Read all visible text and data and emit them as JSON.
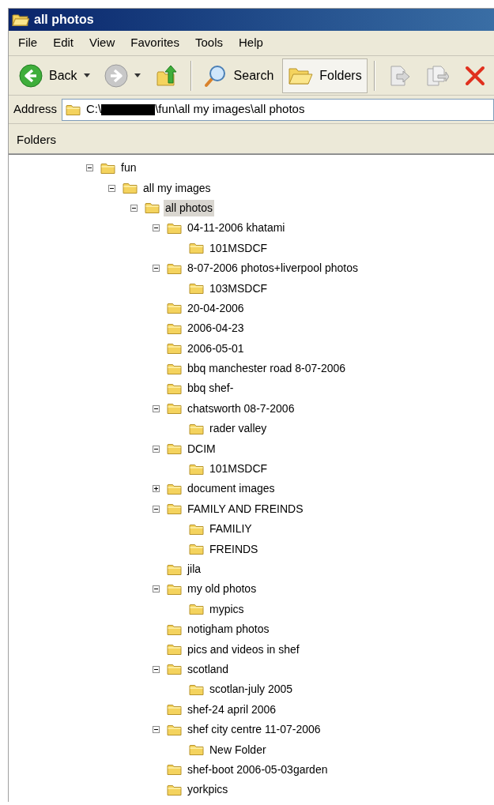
{
  "window": {
    "title": "all photos"
  },
  "menu": [
    {
      "label": "File"
    },
    {
      "label": "Edit"
    },
    {
      "label": "View"
    },
    {
      "label": "Favorites"
    },
    {
      "label": "Tools"
    },
    {
      "label": "Help"
    }
  ],
  "toolbar": [
    {
      "kind": "back",
      "label": "Back",
      "pressed": false
    },
    {
      "kind": "forward",
      "pressed": false
    },
    {
      "kind": "up",
      "pressed": false
    },
    {
      "kind": "separator"
    },
    {
      "kind": "search",
      "label": "Search",
      "pressed": false
    },
    {
      "kind": "folders",
      "label": "Folders",
      "pressed": true
    },
    {
      "kind": "separator"
    },
    {
      "kind": "move",
      "pressed": false
    },
    {
      "kind": "copy",
      "pressed": false
    },
    {
      "kind": "delete",
      "pressed": false
    }
  ],
  "address": {
    "label": "Address",
    "prefix": "C:\\",
    "suffix": "\\fun\\all my images\\all photos"
  },
  "folders_pane": {
    "title": "Folders"
  },
  "tree": [
    {
      "label": "fun",
      "kind": "branch",
      "expanded": true,
      "selected": false,
      "children": [
        {
          "label": "all my images",
          "kind": "branch",
          "expanded": true,
          "selected": false,
          "children": [
            {
              "label": "all photos",
              "kind": "branch",
              "expanded": true,
              "selected": true,
              "children": [
                {
                  "label": "04-11-2006 khatami",
                  "kind": "branch",
                  "expanded": true,
                  "selected": false,
                  "children": [
                    {
                      "label": "101MSDCF",
                      "kind": "leaf",
                      "selected": false
                    }
                  ]
                },
                {
                  "label": "8-07-2006 photos+liverpool photos",
                  "kind": "branch",
                  "expanded": true,
                  "selected": false,
                  "children": [
                    {
                      "label": "103MSDCF",
                      "kind": "leaf",
                      "selected": false
                    }
                  ]
                },
                {
                  "label": "20-04-2006",
                  "kind": "leaf",
                  "selected": false
                },
                {
                  "label": "2006-04-23",
                  "kind": "leaf",
                  "selected": false
                },
                {
                  "label": "2006-05-01",
                  "kind": "leaf",
                  "selected": false
                },
                {
                  "label": "bbq manchester road 8-07-2006",
                  "kind": "leaf",
                  "selected": false
                },
                {
                  "label": "bbq shef-",
                  "kind": "leaf",
                  "selected": false
                },
                {
                  "label": "chatsworth 08-7-2006",
                  "kind": "branch",
                  "expanded": true,
                  "selected": false,
                  "children": [
                    {
                      "label": "rader valley",
                      "kind": "leaf",
                      "selected": false
                    }
                  ]
                },
                {
                  "label": "DCIM",
                  "kind": "branch",
                  "expanded": true,
                  "selected": false,
                  "children": [
                    {
                      "label": "101MSDCF",
                      "kind": "leaf",
                      "selected": false
                    }
                  ]
                },
                {
                  "label": "document images",
                  "kind": "branch",
                  "expanded": false,
                  "selected": false
                },
                {
                  "label": "FAMILY AND FREINDS",
                  "kind": "branch",
                  "expanded": true,
                  "selected": false,
                  "children": [
                    {
                      "label": "FAMILIY",
                      "kind": "leaf",
                      "selected": false
                    },
                    {
                      "label": "FREINDS",
                      "kind": "leaf",
                      "selected": false
                    }
                  ]
                },
                {
                  "label": "jila",
                  "kind": "leaf",
                  "selected": false
                },
                {
                  "label": "my old photos",
                  "kind": "branch",
                  "expanded": true,
                  "selected": false,
                  "children": [
                    {
                      "label": "mypics",
                      "kind": "leaf",
                      "selected": false
                    }
                  ]
                },
                {
                  "label": "notigham photos",
                  "kind": "leaf",
                  "selected": false
                },
                {
                  "label": "pics and videos in shef",
                  "kind": "leaf",
                  "selected": false
                },
                {
                  "label": "scotland",
                  "kind": "branch",
                  "expanded": true,
                  "selected": false,
                  "children": [
                    {
                      "label": "scotlan-july 2005",
                      "kind": "leaf",
                      "selected": false
                    }
                  ]
                },
                {
                  "label": "shef-24 april 2006",
                  "kind": "leaf",
                  "selected": false
                },
                {
                  "label": "shef city centre 11-07-2006",
                  "kind": "branch",
                  "expanded": true,
                  "selected": false,
                  "children": [
                    {
                      "label": "New Folder",
                      "kind": "leaf",
                      "selected": false
                    }
                  ]
                },
                {
                  "label": "shef-boot 2006-05-03garden",
                  "kind": "leaf",
                  "selected": false
                },
                {
                  "label": "yorkpics",
                  "kind": "leaf",
                  "selected": false
                }
              ]
            }
          ]
        }
      ]
    }
  ]
}
